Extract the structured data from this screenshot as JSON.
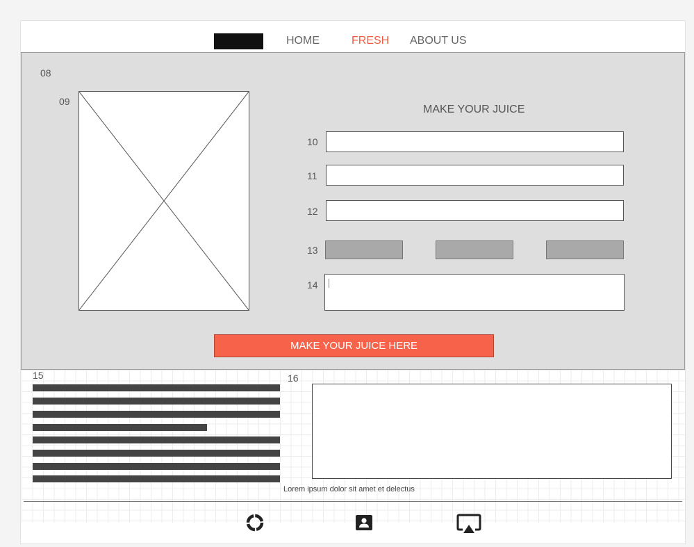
{
  "nav": {
    "links": [
      {
        "label": "HOME",
        "active": false
      },
      {
        "label": "FRESH",
        "active": true
      },
      {
        "label": "ABOUT US",
        "active": false
      }
    ]
  },
  "markers": {
    "m08": "08",
    "m09": "09",
    "m10": "10",
    "m11": "11",
    "m12": "12",
    "m13": "13",
    "m14": "14",
    "m15": "15",
    "m16": "16"
  },
  "form": {
    "title": "MAKE YOUR JUICE",
    "cta_label": "MAKE YOUR JUICE HERE"
  },
  "lower": {
    "caption": "Lorem ipsum dolor sit amet et delectus"
  },
  "footer": {
    "icons": [
      "loading-circle-icon",
      "contact-card-icon",
      "airplay-icon"
    ]
  },
  "colors": {
    "accent": "#f6624a",
    "active_link": "#ef5c43",
    "hero_bg": "#dedede",
    "option_button": "#a9a9a9",
    "text_bar": "#444444"
  }
}
